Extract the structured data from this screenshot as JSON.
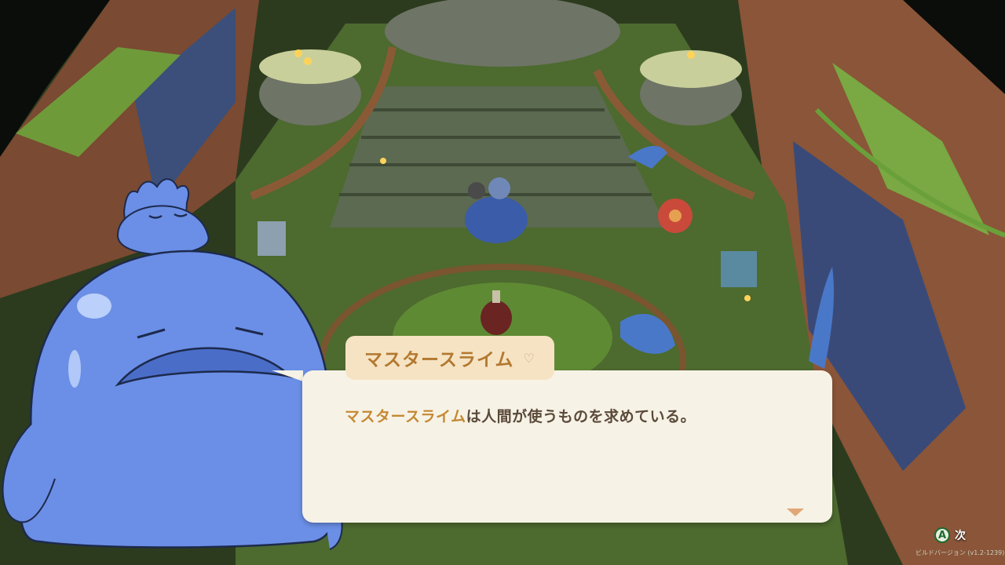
{
  "dialog": {
    "speaker": "マスタースライム",
    "text_highlight": "マスタースライム",
    "text_rest": "は人間が使うものを求めている。"
  },
  "controls": {
    "next_button_glyph": "A",
    "next_label": "次"
  },
  "build_version": "ビルドバージョン (v1.2-1239)",
  "icons": {
    "speaker_heart": "heart-icon",
    "advance": "advance-arrow-icon",
    "a_button": "a-button-icon"
  },
  "colors": {
    "dialog_bg": "#f7f2e6",
    "speaker_tag_bg": "#f5e3c3",
    "speaker_name": "#b3782f",
    "highlight": "#c48932",
    "slime": "#6b8fe6"
  }
}
